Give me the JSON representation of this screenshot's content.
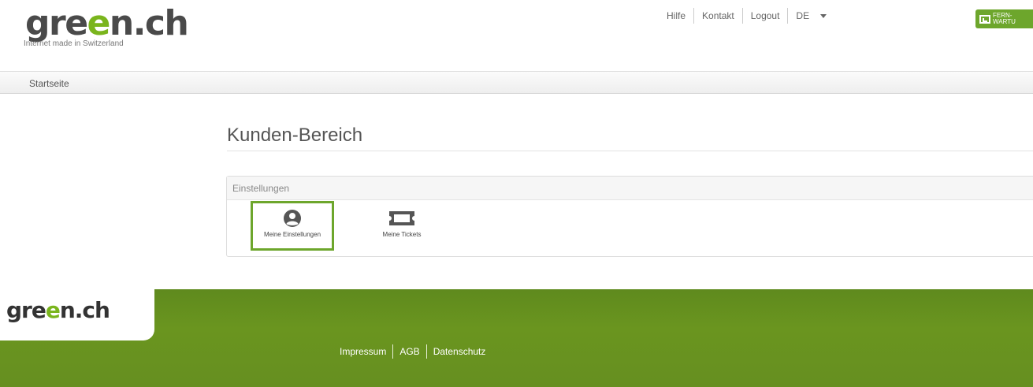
{
  "header": {
    "logo": {
      "part1": "gre",
      "accent": "e",
      "part2": "n.ch"
    },
    "tagline": "Internet made in Switzerland",
    "nav": [
      "Hilfe",
      "Kontakt",
      "Logout"
    ],
    "language": "DE",
    "remote_button": {
      "line1": "FERN-",
      "line2": "WARTU"
    }
  },
  "breadcrumb": {
    "item": "Startseite"
  },
  "main": {
    "title": "Kunden-Bereich",
    "panel": {
      "heading": "Einstellungen",
      "tiles": [
        {
          "label": "Meine Einstellungen",
          "icon": "user-icon",
          "active": true
        },
        {
          "label": "Meine Tickets",
          "icon": "ticket-icon",
          "active": false
        }
      ]
    }
  },
  "footer": {
    "logo": {
      "part1": "gre",
      "accent": "e",
      "part2": "n.ch"
    },
    "links": [
      "Impressum",
      "AGB",
      "Datenschutz"
    ]
  },
  "colors": {
    "brand_green": "#6da62c",
    "footer_green": "#668f20",
    "text": "#555555"
  }
}
